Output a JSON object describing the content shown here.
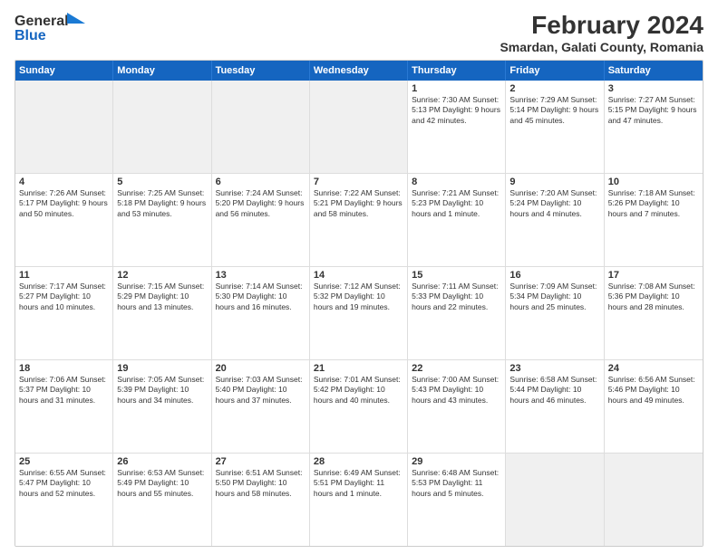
{
  "header": {
    "logo_general": "General",
    "logo_blue": "Blue",
    "main_title": "February 2024",
    "subtitle": "Smardan, Galati County, Romania"
  },
  "days_of_week": [
    "Sunday",
    "Monday",
    "Tuesday",
    "Wednesday",
    "Thursday",
    "Friday",
    "Saturday"
  ],
  "weeks": [
    [
      {
        "day": "",
        "content": "",
        "shaded": true
      },
      {
        "day": "",
        "content": "",
        "shaded": true
      },
      {
        "day": "",
        "content": "",
        "shaded": true
      },
      {
        "day": "",
        "content": "",
        "shaded": true
      },
      {
        "day": "1",
        "content": "Sunrise: 7:30 AM\nSunset: 5:13 PM\nDaylight: 9 hours\nand 42 minutes."
      },
      {
        "day": "2",
        "content": "Sunrise: 7:29 AM\nSunset: 5:14 PM\nDaylight: 9 hours\nand 45 minutes."
      },
      {
        "day": "3",
        "content": "Sunrise: 7:27 AM\nSunset: 5:15 PM\nDaylight: 9 hours\nand 47 minutes."
      }
    ],
    [
      {
        "day": "4",
        "content": "Sunrise: 7:26 AM\nSunset: 5:17 PM\nDaylight: 9 hours\nand 50 minutes."
      },
      {
        "day": "5",
        "content": "Sunrise: 7:25 AM\nSunset: 5:18 PM\nDaylight: 9 hours\nand 53 minutes."
      },
      {
        "day": "6",
        "content": "Sunrise: 7:24 AM\nSunset: 5:20 PM\nDaylight: 9 hours\nand 56 minutes."
      },
      {
        "day": "7",
        "content": "Sunrise: 7:22 AM\nSunset: 5:21 PM\nDaylight: 9 hours\nand 58 minutes."
      },
      {
        "day": "8",
        "content": "Sunrise: 7:21 AM\nSunset: 5:23 PM\nDaylight: 10 hours\nand 1 minute."
      },
      {
        "day": "9",
        "content": "Sunrise: 7:20 AM\nSunset: 5:24 PM\nDaylight: 10 hours\nand 4 minutes."
      },
      {
        "day": "10",
        "content": "Sunrise: 7:18 AM\nSunset: 5:26 PM\nDaylight: 10 hours\nand 7 minutes."
      }
    ],
    [
      {
        "day": "11",
        "content": "Sunrise: 7:17 AM\nSunset: 5:27 PM\nDaylight: 10 hours\nand 10 minutes."
      },
      {
        "day": "12",
        "content": "Sunrise: 7:15 AM\nSunset: 5:29 PM\nDaylight: 10 hours\nand 13 minutes."
      },
      {
        "day": "13",
        "content": "Sunrise: 7:14 AM\nSunset: 5:30 PM\nDaylight: 10 hours\nand 16 minutes."
      },
      {
        "day": "14",
        "content": "Sunrise: 7:12 AM\nSunset: 5:32 PM\nDaylight: 10 hours\nand 19 minutes."
      },
      {
        "day": "15",
        "content": "Sunrise: 7:11 AM\nSunset: 5:33 PM\nDaylight: 10 hours\nand 22 minutes."
      },
      {
        "day": "16",
        "content": "Sunrise: 7:09 AM\nSunset: 5:34 PM\nDaylight: 10 hours\nand 25 minutes."
      },
      {
        "day": "17",
        "content": "Sunrise: 7:08 AM\nSunset: 5:36 PM\nDaylight: 10 hours\nand 28 minutes."
      }
    ],
    [
      {
        "day": "18",
        "content": "Sunrise: 7:06 AM\nSunset: 5:37 PM\nDaylight: 10 hours\nand 31 minutes."
      },
      {
        "day": "19",
        "content": "Sunrise: 7:05 AM\nSunset: 5:39 PM\nDaylight: 10 hours\nand 34 minutes."
      },
      {
        "day": "20",
        "content": "Sunrise: 7:03 AM\nSunset: 5:40 PM\nDaylight: 10 hours\nand 37 minutes."
      },
      {
        "day": "21",
        "content": "Sunrise: 7:01 AM\nSunset: 5:42 PM\nDaylight: 10 hours\nand 40 minutes."
      },
      {
        "day": "22",
        "content": "Sunrise: 7:00 AM\nSunset: 5:43 PM\nDaylight: 10 hours\nand 43 minutes."
      },
      {
        "day": "23",
        "content": "Sunrise: 6:58 AM\nSunset: 5:44 PM\nDaylight: 10 hours\nand 46 minutes."
      },
      {
        "day": "24",
        "content": "Sunrise: 6:56 AM\nSunset: 5:46 PM\nDaylight: 10 hours\nand 49 minutes."
      }
    ],
    [
      {
        "day": "25",
        "content": "Sunrise: 6:55 AM\nSunset: 5:47 PM\nDaylight: 10 hours\nand 52 minutes."
      },
      {
        "day": "26",
        "content": "Sunrise: 6:53 AM\nSunset: 5:49 PM\nDaylight: 10 hours\nand 55 minutes."
      },
      {
        "day": "27",
        "content": "Sunrise: 6:51 AM\nSunset: 5:50 PM\nDaylight: 10 hours\nand 58 minutes."
      },
      {
        "day": "28",
        "content": "Sunrise: 6:49 AM\nSunset: 5:51 PM\nDaylight: 11 hours\nand 1 minute."
      },
      {
        "day": "29",
        "content": "Sunrise: 6:48 AM\nSunset: 5:53 PM\nDaylight: 11 hours\nand 5 minutes."
      },
      {
        "day": "",
        "content": "",
        "shaded": true
      },
      {
        "day": "",
        "content": "",
        "shaded": true
      }
    ]
  ]
}
